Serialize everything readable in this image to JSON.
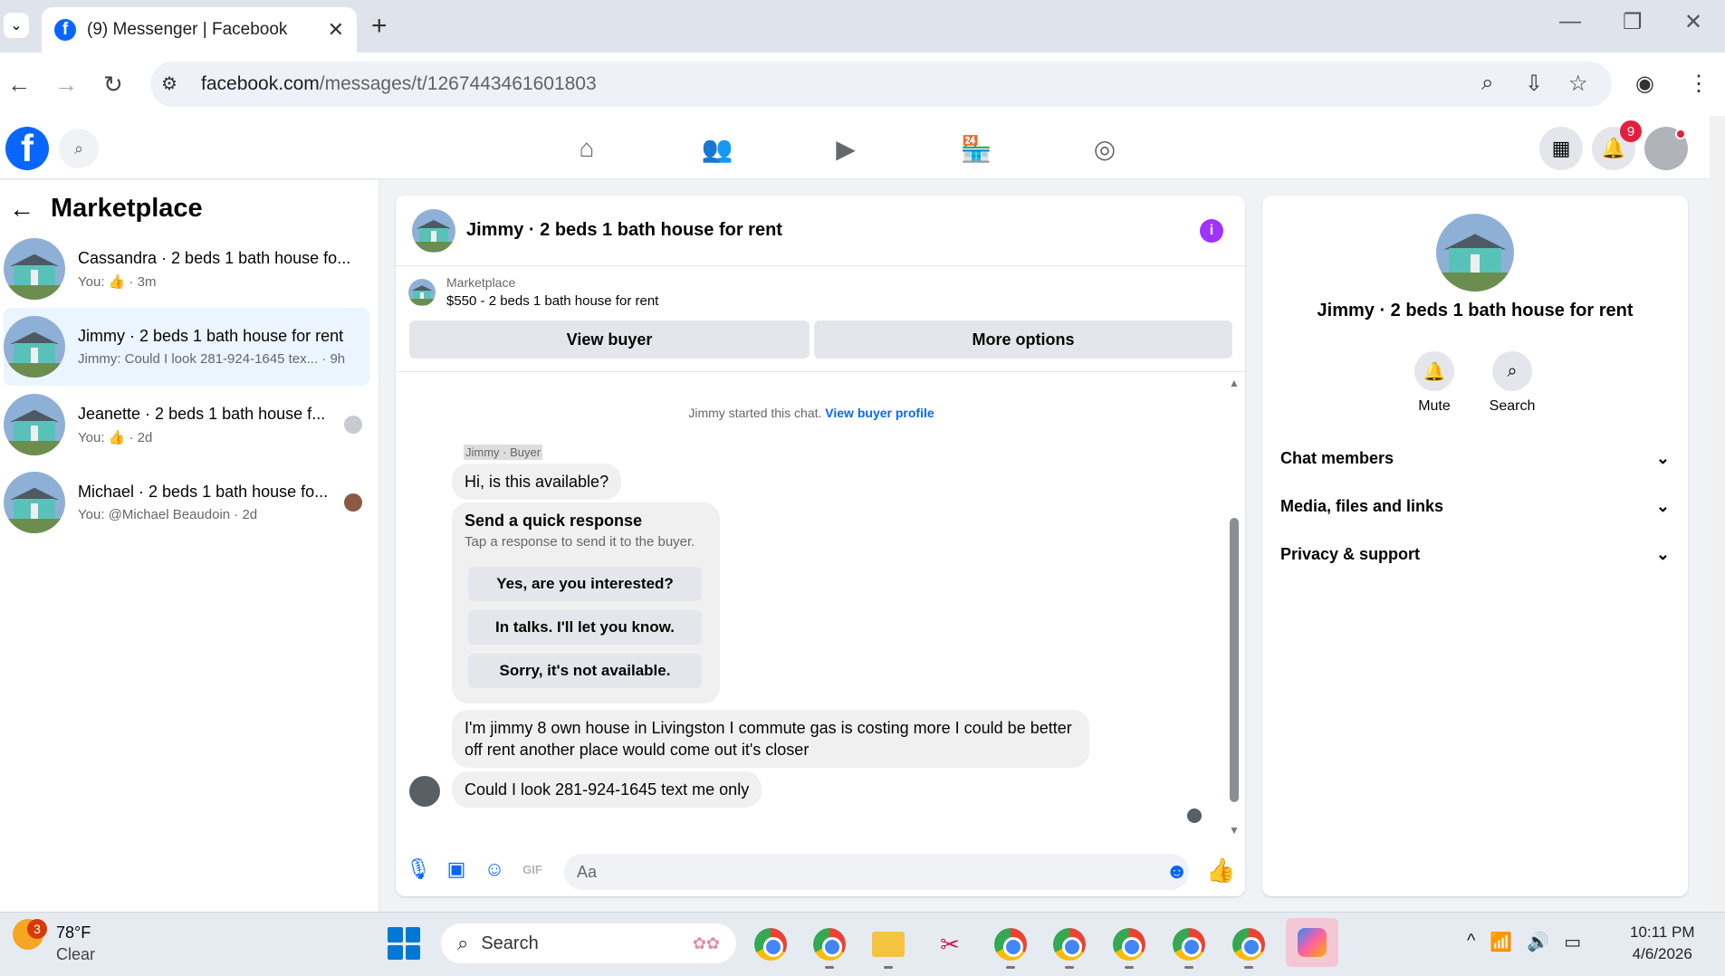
{
  "browser": {
    "tab_title": "(9) Messenger | Facebook",
    "url_host": "facebook.com",
    "url_path": "/messages/t/1267443461601803"
  },
  "fb_header": {
    "notification_count": "9"
  },
  "sidebar": {
    "title": "Marketplace",
    "conversations": [
      {
        "name": "Cassandra · 2 beds 1 bath house fo...",
        "preview": "You: 👍 · 3m"
      },
      {
        "name": "Jimmy · 2 beds 1 bath house for rent",
        "preview": "Jimmy: Could I look 281-924-1645 tex... · 9h"
      },
      {
        "name": "Jeanette · 2 beds 1 bath house f...",
        "preview": "You: 👍 · 2d"
      },
      {
        "name": "Michael · 2 beds 1 bath house fo...",
        "preview": "You: @Michael Beaudoin · 2d"
      }
    ]
  },
  "chat": {
    "title": "Jimmy · 2 beds 1 bath house for rent",
    "listing_label": "Marketplace",
    "listing_title": "$550 - 2 beds 1 bath house for rent",
    "view_buyer": "View buyer",
    "more_options": "More options",
    "started_text": "Jimmy started this chat.",
    "view_profile": "View buyer profile",
    "buyer_label": "Jimmy · Buyer",
    "msg1": "Hi, is this available?",
    "quick_title": "Send a quick response",
    "quick_sub": "Tap a response to send it to the buyer.",
    "quick_responses": [
      "Yes, are you interested?",
      "In talks. I'll let you know.",
      "Sorry, it's not available."
    ],
    "msg2": "I'm jimmy 8 own house in Livingston I commute gas is costing more I could be better off rent another place would come out it's closer",
    "msg3": "Could I look 281-924-1645 text me only",
    "input_placeholder": "Aa"
  },
  "right_panel": {
    "name": "Jimmy · 2 beds 1 bath house for rent",
    "mute": "Mute",
    "search": "Search",
    "sections": [
      "Chat members",
      "Media, files and links",
      "Privacy & support"
    ]
  },
  "taskbar": {
    "temp": "78°F",
    "condition": "Clear",
    "weather_badge": "3",
    "search": "Search",
    "time": "10:11 PM",
    "date": "4/6/2026"
  },
  "colors": {
    "fb_blue": "#0866ff",
    "selected_row": "#ebf5ff",
    "info_purple": "#a033ff"
  }
}
